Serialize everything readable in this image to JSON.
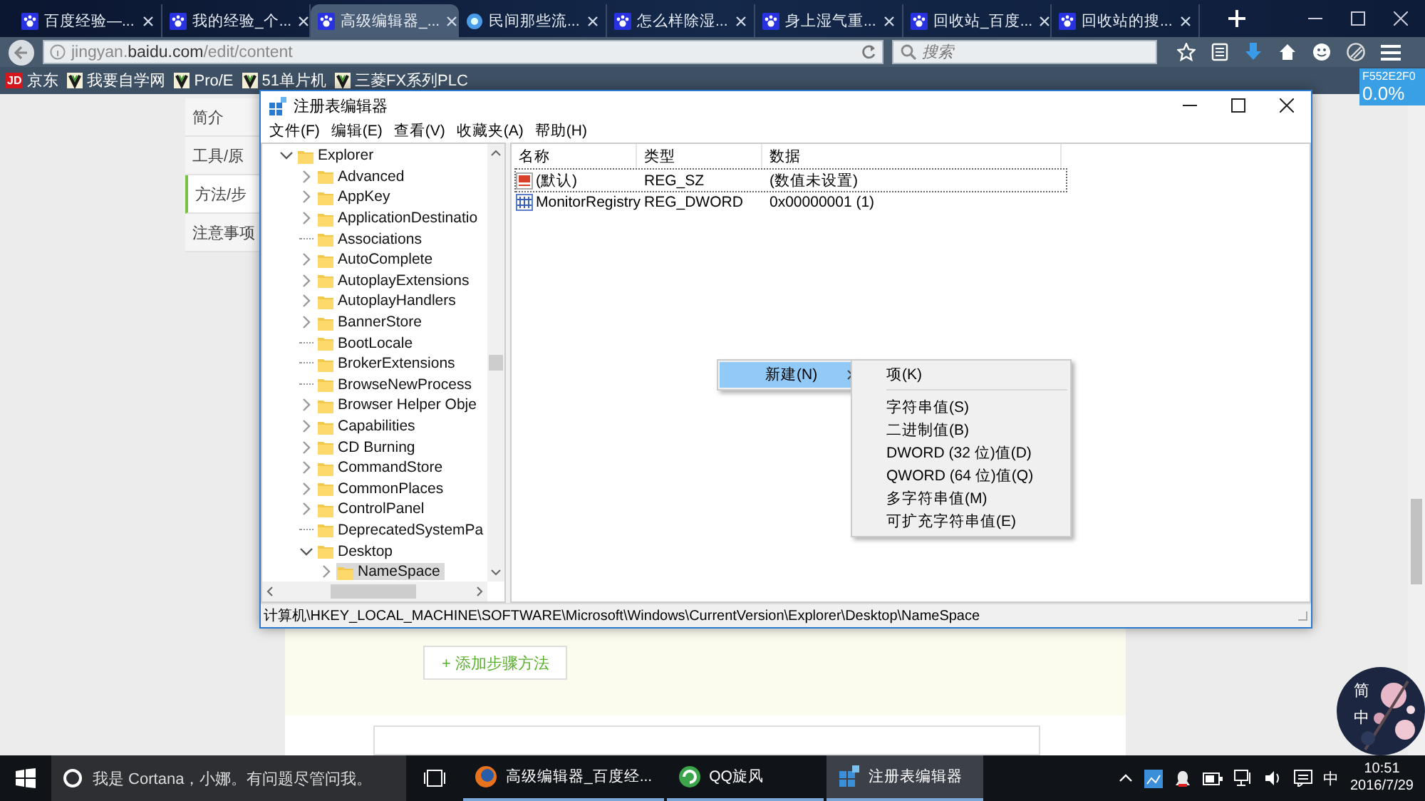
{
  "browser": {
    "tabs": [
      {
        "label": "百度经验—...",
        "kind": "paw",
        "selected": false
      },
      {
        "label": "我的经验_个...",
        "kind": "paw",
        "selected": false
      },
      {
        "label": "高级编辑器_...",
        "kind": "paw",
        "selected": true
      },
      {
        "label": "民间那些流...",
        "kind": "globe",
        "selected": false
      },
      {
        "label": "怎么样除湿...",
        "kind": "paw",
        "selected": false
      },
      {
        "label": "身上湿气重...",
        "kind": "paw",
        "selected": false
      },
      {
        "label": "回收站_百度...",
        "kind": "paw",
        "selected": false
      },
      {
        "label": "回收站的搜...",
        "kind": "paw",
        "selected": false
      }
    ],
    "address": {
      "value": "jingyan.**baidu.com**/edit/content"
    },
    "search": {
      "placeholder": "搜索"
    },
    "bookmarks": [
      {
        "kind": "jd",
        "icon_text": "JD",
        "label": "京东"
      },
      {
        "kind": "v",
        "label": "我要自学网"
      },
      {
        "kind": "v",
        "label": "Pro/E"
      },
      {
        "kind": "v",
        "label": "51单片机"
      },
      {
        "kind": "v",
        "label": "三菱FX系列PLC"
      }
    ]
  },
  "tooltip": {
    "lines": [
      "F552E2F0",
      "0.0%"
    ]
  },
  "page": {
    "side_nav": [
      {
        "label": "简介",
        "selected": false
      },
      {
        "label": "工具/原",
        "selected": false
      },
      {
        "label": "方法/步",
        "selected": true
      },
      {
        "label": "注意事项",
        "selected": false
      }
    ],
    "add_step_button": "+ 添加步骤方法"
  },
  "regedit": {
    "title": "注册表编辑器",
    "menu": [
      "文件(F)",
      "编辑(E)",
      "查看(V)",
      "收藏夹(A)",
      "帮助(H)"
    ],
    "tree": [
      {
        "label": "Explorer",
        "kind": "folder",
        "expanded": true,
        "selected": false,
        "children": [
          {
            "label": "Advanced",
            "kind": "folder",
            "expanded": false,
            "selected": false
          },
          {
            "label": "AppKey",
            "kind": "folder",
            "expanded": false,
            "selected": false
          },
          {
            "label": "ApplicationDestinatio",
            "kind": "folder",
            "expanded": false,
            "selected": false
          },
          {
            "label": "Associations",
            "kind": "leaf",
            "selected": false
          },
          {
            "label": "AutoComplete",
            "kind": "folder",
            "expanded": false,
            "selected": false
          },
          {
            "label": "AutoplayExtensions",
            "kind": "folder",
            "expanded": false,
            "selected": false
          },
          {
            "label": "AutoplayHandlers",
            "kind": "folder",
            "expanded": false,
            "selected": false
          },
          {
            "label": "BannerStore",
            "kind": "folder",
            "expanded": false,
            "selected": false
          },
          {
            "label": "BootLocale",
            "kind": "leaf",
            "selected": false
          },
          {
            "label": "BrokerExtensions",
            "kind": "leaf",
            "selected": false
          },
          {
            "label": "BrowseNewProcess",
            "kind": "leaf",
            "selected": false
          },
          {
            "label": "Browser Helper Obje",
            "kind": "folder",
            "expanded": false,
            "selected": false
          },
          {
            "label": "Capabilities",
            "kind": "folder",
            "expanded": false,
            "selected": false
          },
          {
            "label": "CD Burning",
            "kind": "folder",
            "expanded": false,
            "selected": false
          },
          {
            "label": "CommandStore",
            "kind": "folder",
            "expanded": false,
            "selected": false
          },
          {
            "label": "CommonPlaces",
            "kind": "folder",
            "expanded": false,
            "selected": false
          },
          {
            "label": "ControlPanel",
            "kind": "folder",
            "expanded": false,
            "selected": false
          },
          {
            "label": "DeprecatedSystemPa",
            "kind": "leaf",
            "selected": false
          },
          {
            "label": "Desktop",
            "kind": "folder",
            "expanded": true,
            "selected": false,
            "children": [
              {
                "label": "NameSpace",
                "kind": "folder",
                "expanded": false,
                "selected": true
              }
            ]
          }
        ]
      }
    ],
    "columns": [
      "名称",
      "类型",
      "数据"
    ],
    "rows": [
      {
        "kind": "string",
        "name": "(默认)",
        "type": "REG_SZ",
        "data": "(数值未设置)",
        "focused": true
      },
      {
        "kind": "binary",
        "name": "MonitorRegistry",
        "type": "REG_DWORD",
        "data": "0x00000001 (1)",
        "focused": false
      }
    ],
    "status_bar": "计算机\\HKEY_LOCAL_MACHINE\\SOFTWARE\\Microsoft\\Windows\\CurrentVersion\\Explorer\\Desktop\\NameSpace"
  },
  "context_menu": {
    "items": [
      {
        "label": "新建(N)",
        "selected": true,
        "submenu": true
      }
    ]
  },
  "submenu": {
    "items": [
      {
        "kind": "item",
        "label": "项(K)"
      },
      {
        "kind": "separator"
      },
      {
        "kind": "item",
        "label": "字符串值(S)"
      },
      {
        "kind": "item",
        "label": "二进制值(B)"
      },
      {
        "kind": "item",
        "label": "DWORD (32 位)值(D)"
      },
      {
        "kind": "item",
        "label": "QWORD (64 位)值(Q)"
      },
      {
        "kind": "item",
        "label": "多字符串值(M)"
      },
      {
        "kind": "item",
        "label": "可扩充字符串值(E)"
      }
    ]
  },
  "ime_widget": {
    "labels": [
      "简",
      "中"
    ]
  },
  "taskbar": {
    "search_placeholder": "我是 Cortana，小娜。有问题尽管问我。",
    "apps": [
      {
        "kind": "firefox",
        "label": "高级编辑器_百度经...",
        "selected": false
      },
      {
        "kind": "qq",
        "label": "QQ旋风",
        "selected": false
      },
      {
        "kind": "regedit",
        "label": "注册表编辑器",
        "selected": true
      }
    ],
    "ime": "中",
    "time": "10:51",
    "date": "2016/7/29"
  }
}
